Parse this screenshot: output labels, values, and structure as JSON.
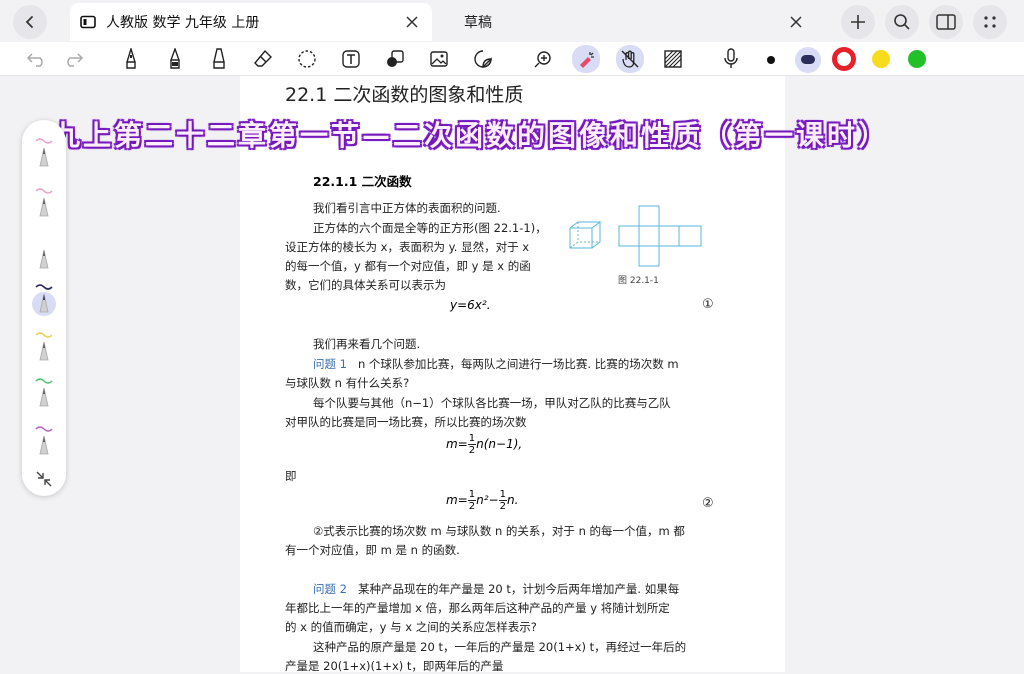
{
  "tabs": [
    {
      "title": "人教版 数学 九年级 上册",
      "active": true
    },
    {
      "title": "草稿",
      "active": false
    }
  ],
  "toolbar": {
    "tools": [
      "undo-icon",
      "redo-icon",
      "pen-icon",
      "fountain-pen-icon",
      "highlighter-icon",
      "eraser-icon",
      "lasso-icon",
      "text-tool-icon",
      "shape-icon",
      "image-icon",
      "sticker-icon",
      "zoom-in-icon",
      "laser-pointer-icon",
      "hand-icon",
      "pattern-icon",
      "microphone-icon"
    ],
    "colors": [
      "#111111",
      "#2b2f5a",
      "#e8202a",
      "#f7dc1e",
      "#22c12a"
    ]
  },
  "overlay_title": "九上第二十二章第一节—二次函数的图像和性质（第一课时）",
  "document": {
    "section_title": "22.1  二次函数的图象和性质",
    "subsection_title": "22.1.1   二次函数",
    "p1": "我们看引言中正方体的表面积的问题.",
    "p2_l1": "正方体的六个面是全等的正方形(图 22.1-1)，",
    "p2_l2": "设正方体的棱长为 x，表面积为 y. 显然，对于 x",
    "p2_l3": "的每一个值，y 都有一个对应值，即 y 是 x 的函",
    "p2_l4": "数，它们的具体关系可以表示为",
    "eq1": "y=6x².",
    "eq1_num": "①",
    "fig_caption": "图 22.1-1",
    "p3": "我们再来看几个问题.",
    "q1_label": "问题 1",
    "q1_l1": "n 个球队参加比赛，每两队之间进行一场比赛. 比赛的场次数 m",
    "q1_l2": "与球队数 n 有什么关系?",
    "q1_a1": "每个队要与其他（n−1）个球队各比赛一场，甲队对乙队的比赛与乙队",
    "q1_a2": "对甲队的比赛是同一场比赛，所以比赛的场次数",
    "eq2_left": "m=",
    "eq2_frac_num": "1",
    "eq2_frac_den": "2",
    "eq2_right": "n(n−1),",
    "ji": "即",
    "eq3_left": "m=",
    "eq3_frac1_num": "1",
    "eq3_frac1_den": "2",
    "eq3_mid": "n²−",
    "eq3_frac2_num": "1",
    "eq3_frac2_den": "2",
    "eq3_right": "n.",
    "eq3_num": "②",
    "p4_l1": "②式表示比赛的场次数 m 与球队数 n 的关系，对于 n 的每一个值，m 都",
    "p4_l2": "有一个对应值，即 m 是 n 的函数.",
    "q2_label": "问题 2",
    "q2_l1": "某种产品现在的年产量是 20 t，计划今后两年增加产量. 如果每",
    "q2_l2": "年都比上一年的产量增加 x 倍，那么两年后这种产品的产量 y 将随计划所定",
    "q2_l3": "的 x 的值而确定，y 与 x 之间的关系应怎样表示?",
    "q2_a1": "这种产品的原产量是 20 t，一年后的产量是 20(1+x) t，再经过一年后的",
    "q2_a2": "产量是 20(1+x)(1+x) t，即两年后的产量"
  }
}
